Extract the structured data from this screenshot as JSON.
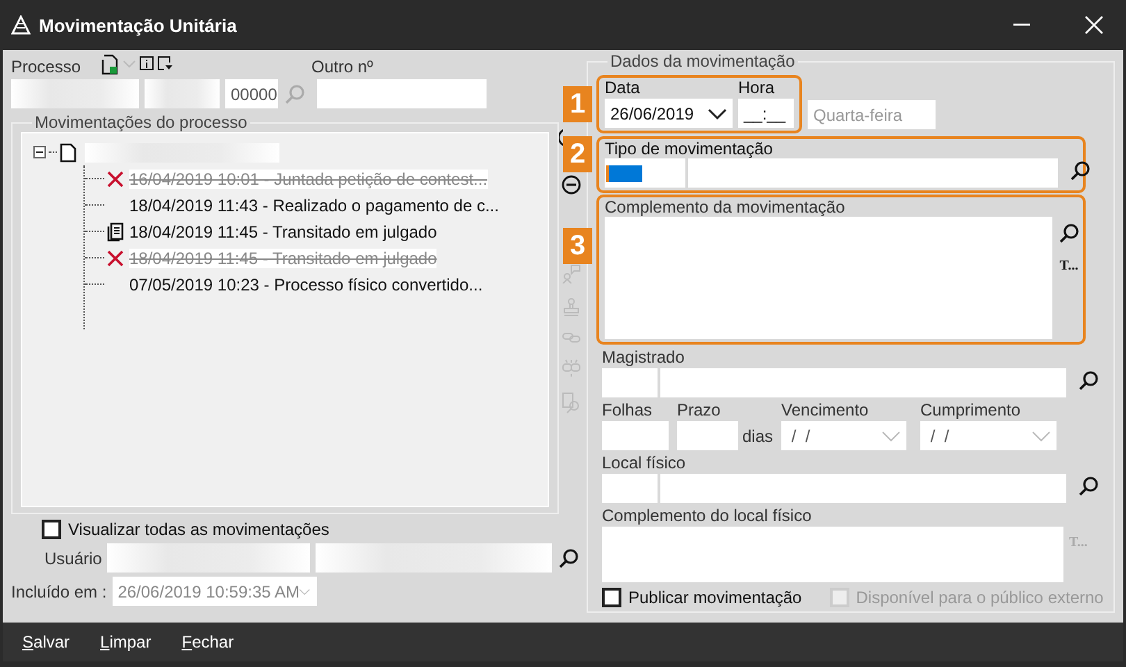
{
  "window": {
    "title": "Movimentação Unitária"
  },
  "processo": {
    "label": "Processo",
    "suffix": "00000",
    "other_label": "Outro nº"
  },
  "movements": {
    "legend": "Movimentações do processo",
    "root_expanded": true,
    "children": [
      {
        "kind": "deleted",
        "text": "16/04/2019 10:01 - Juntada petição de contest..."
      },
      {
        "kind": "plain",
        "text": "18/04/2019 11:43 - Realizado o pagamento de c..."
      },
      {
        "kind": "document",
        "text": "18/04/2019 11:45 - Transitado em julgado"
      },
      {
        "kind": "deleted",
        "text": "18/04/2019 11:45 - Transitado em julgado"
      },
      {
        "kind": "plain",
        "text": "07/05/2019 10:23 - Processo físico convertido..."
      }
    ]
  },
  "show_all": {
    "label": "Visualizar todas as movimentações",
    "checked": false
  },
  "user": {
    "label": "Usuário"
  },
  "included": {
    "label": "Incluído em :",
    "value": "26/06/2019 10:59:35 AM"
  },
  "details": {
    "legend": "Dados da movimentação",
    "date": {
      "label": "Data",
      "value": "26/06/2019"
    },
    "time": {
      "label": "Hora",
      "value": "__:__"
    },
    "weekday": "Quarta-feira",
    "type": {
      "label": "Tipo de movimentação"
    },
    "complement": {
      "label": "Complemento da movimentação",
      "text_button": "T..."
    },
    "judge": {
      "label": "Magistrado"
    },
    "sheets": {
      "label": "Folhas"
    },
    "term": {
      "label": "Prazo",
      "unit": "dias"
    },
    "due": {
      "label": "Vencimento",
      "value": " /  /"
    },
    "fulfillment": {
      "label": "Cumprimento",
      "value": " /  /"
    },
    "location": {
      "label": "Local físico"
    },
    "location_complement": {
      "label": "Complemento do local físico",
      "text_button": "T..."
    },
    "publish": {
      "label": "Publicar movimentação",
      "checked": false
    },
    "public": {
      "label": "Disponível para o público externo",
      "checked": false,
      "disabled": true
    }
  },
  "annotations": [
    "1",
    "2",
    "3"
  ],
  "buttons": [
    "Salvar",
    "Limpar",
    "Fechar"
  ]
}
